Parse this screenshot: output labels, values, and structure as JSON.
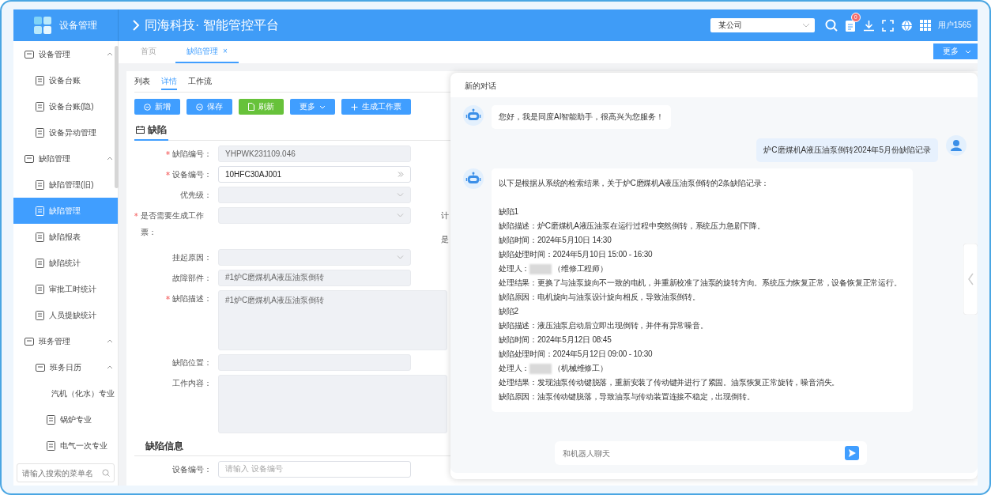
{
  "header": {
    "app_name": "设备管理",
    "platform_title": "同海科技· 智能管控平台",
    "company_select": {
      "value": "某公司"
    },
    "notification_count": "0",
    "user": "用户1565"
  },
  "sidebar": {
    "items": [
      {
        "label": "设备管理",
        "expanded": true,
        "selected": false,
        "children": [
          {
            "label": "设备台账",
            "selected": false
          },
          {
            "label": "设备台账(隐)",
            "selected": false
          },
          {
            "label": "设备异动管理",
            "selected": false
          }
        ]
      },
      {
        "label": "缺陷管理",
        "expanded": true,
        "selected": false,
        "children": [
          {
            "label": "缺陷管理(旧)",
            "selected": false
          },
          {
            "label": "缺陷管理",
            "selected": true
          },
          {
            "label": "缺陷报表",
            "selected": false
          },
          {
            "label": "缺陷统计",
            "selected": false
          },
          {
            "label": "审批工时统计",
            "selected": false
          },
          {
            "label": "人员提缺统计",
            "selected": false
          }
        ]
      },
      {
        "label": "班务管理",
        "expanded": true,
        "selected": false,
        "children": [
          {
            "label": "班务日历",
            "expanded": true,
            "selected": false,
            "children": [
              {
                "label": "汽机（化水）专业",
                "selected": false
              },
              {
                "label": "锅炉专业",
                "selected": false
              },
              {
                "label": "电气一次专业",
                "selected": false
              }
            ]
          }
        ]
      }
    ],
    "search": {
      "placeholder": "请输入搜索的菜单名"
    }
  },
  "page_tabs": [
    {
      "label": "首页",
      "selected": false
    },
    {
      "label": "缺陷管理",
      "close": "×",
      "selected": true
    }
  ],
  "more_button": "更多",
  "view_tabs": [
    {
      "label": "列表",
      "selected": false
    },
    {
      "label": "详情",
      "selected": true
    },
    {
      "label": "工作流",
      "selected": false
    }
  ],
  "toolbar": [
    {
      "label": "新增",
      "kind": "add"
    },
    {
      "label": "保存",
      "kind": "save"
    },
    {
      "label": "刷新",
      "kind": "refresh"
    },
    {
      "label": "更多",
      "kind": "menu"
    },
    {
      "label": "生成工作票",
      "kind": "create"
    }
  ],
  "section_title": "缺陷",
  "form": [
    {
      "label": "缺陷编号：",
      "required": true,
      "kind": "text",
      "disabled": true,
      "value": "YHPWK231109.046"
    },
    {
      "label": "设备编号：",
      "required": true,
      "kind": "picker",
      "disabled": false,
      "value": "10HFC30AJ001"
    },
    {
      "label": "优先级：",
      "required": false,
      "kind": "select",
      "disabled": true
    },
    {
      "label": "是否需要生成工作票：",
      "required": true,
      "kind": "select",
      "disabled": true,
      "column_2_labels": [
        "计",
        "是"
      ]
    },
    {
      "label": "挂起原因：",
      "required": false,
      "kind": "select",
      "disabled": true
    },
    {
      "label": "故障部件：",
      "required": false,
      "kind": "text",
      "disabled": true,
      "value": "#1炉C磨煤机A液压油泵倒转"
    },
    {
      "label": "缺陷描述：",
      "required": true,
      "kind": "textarea",
      "disabled": true,
      "value": "#1炉C磨煤机A液压油泵倒转"
    },
    {
      "label": "缺陷位置：",
      "required": false,
      "kind": "text",
      "disabled": true
    },
    {
      "label": "工作内容：",
      "required": false,
      "kind": "textarea",
      "disabled": true
    }
  ],
  "info_section": {
    "title": "缺陷信息",
    "fields": [
      {
        "label": "设备编号：",
        "kind": "text",
        "disabled": false,
        "placeholder": "请输入 设备编号"
      }
    ]
  },
  "chat": {
    "title": "新的对话",
    "messages": [
      {
        "kind": "bot",
        "lines": [
          {
            "kind": "text",
            "text": "您好，我是同度AI智能助手，很高兴为您服务！"
          }
        ]
      },
      {
        "kind": "user",
        "lines": [
          {
            "kind": "text",
            "text": "炉C磨煤机A液压油泵倒转2024年5月份缺陷记录"
          }
        ]
      },
      {
        "kind": "bot",
        "lines": [
          {
            "kind": "text",
            "text": "以下是根据从系统的检索结果，关于炉C磨煤机A液压油泵倒转的2条缺陷记录："
          },
          {
            "kind": "blank"
          },
          {
            "kind": "text",
            "text": "缺陷1"
          },
          {
            "kind": "text",
            "text": "缺陷描述：炉C磨煤机A液压油泵在运行过程中突然倒转，系统压力急剧下降。"
          },
          {
            "kind": "text",
            "text": "缺陷时间：2024年5月10日 14:30"
          },
          {
            "kind": "text",
            "text": "缺陷处理时间：2024年5月10日 15:00 - 16:30"
          },
          {
            "kind": "redacted",
            "before": "处理人：",
            "after": "（维修工程师）"
          },
          {
            "kind": "text",
            "text": "处理结果：更换了与油泵旋向不一致的电机，并重新校准了油泵的旋转方向。系统压力恢复正常，设备恢复正常运行。"
          },
          {
            "kind": "text",
            "text": "缺陷原因：电机旋向与油泵设计旋向相反，导致油泵倒转。"
          },
          {
            "kind": "text",
            "text": "缺陷2"
          },
          {
            "kind": "text",
            "text": "缺陷描述：液压油泵启动后立即出现倒转，并伴有异常噪音。"
          },
          {
            "kind": "text",
            "text": "缺陷时间：2024年5月12日 08:45"
          },
          {
            "kind": "text",
            "text": "缺陷处理时间：2024年5月12日 09:00 - 10:30"
          },
          {
            "kind": "redacted",
            "before": "处理人：",
            "after": "（机械维修工）"
          },
          {
            "kind": "text",
            "text": "处理结果：发现油泵传动键脱落，重新安装了传动键并进行了紧固。油泵恢复正常旋转，噪音消失。"
          },
          {
            "kind": "text",
            "text": "缺陷原因：油泵传动键脱落，导致油泵与传动装置连接不稳定，出现倒转。"
          }
        ]
      }
    ],
    "input": {
      "placeholder": "和机器人聊天"
    }
  }
}
